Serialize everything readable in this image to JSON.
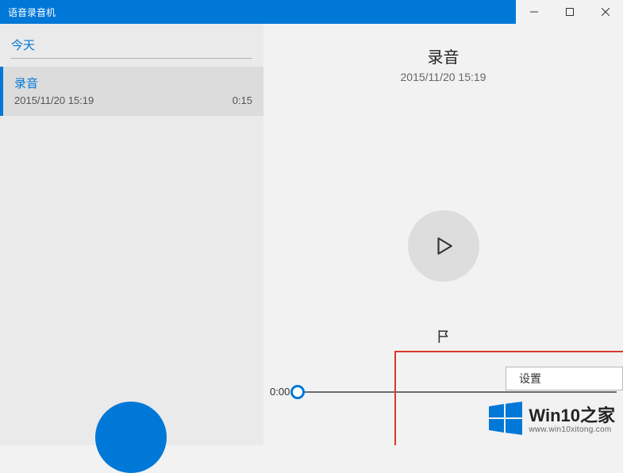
{
  "titlebar": {
    "title": "语音录音机"
  },
  "sidebar": {
    "section_label": "今天",
    "item": {
      "title": "录音",
      "datetime": "2015/11/20 15:19",
      "duration": "0:15"
    }
  },
  "content": {
    "title": "录音",
    "datetime": "2015/11/20 15:19",
    "current_time": "0:00"
  },
  "menu": {
    "settings_label": "设置"
  },
  "watermark": {
    "brand": "Win10",
    "suffix": "之家",
    "url": "www.win10xitong.com"
  }
}
